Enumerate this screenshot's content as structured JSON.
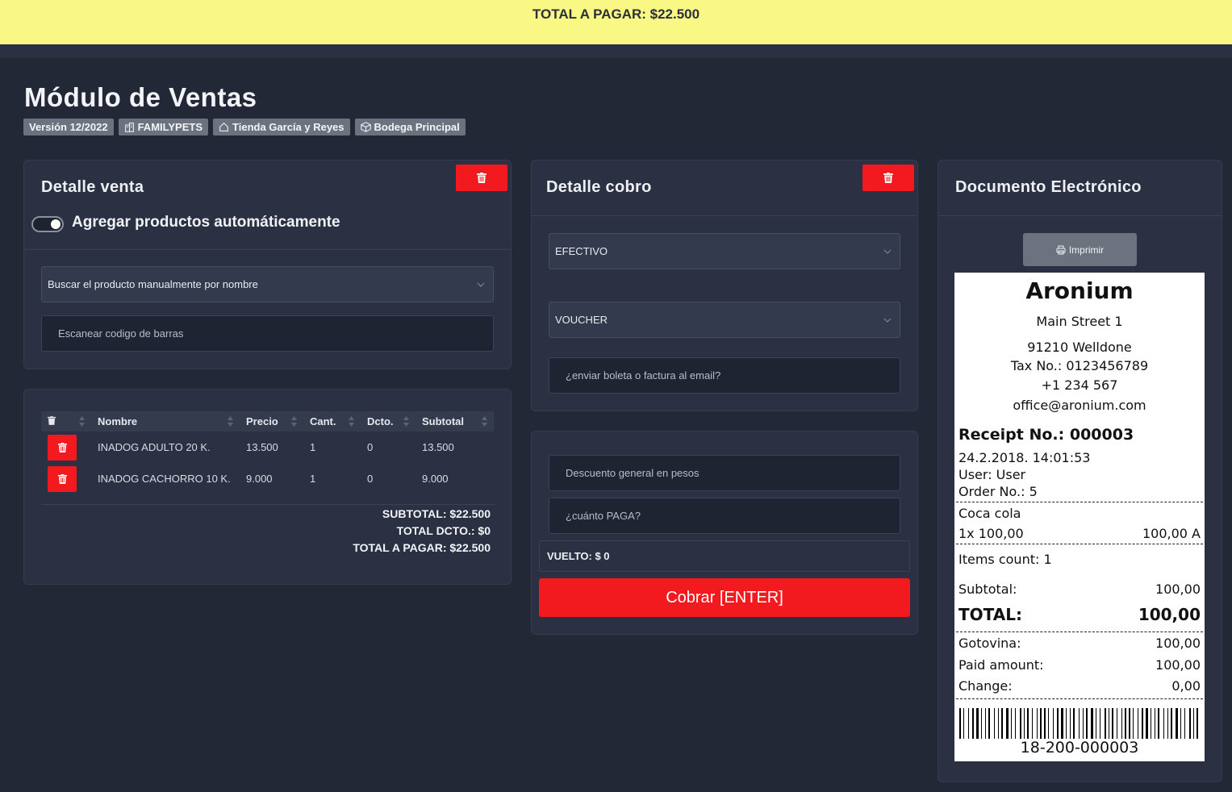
{
  "header": {
    "total_banner": "TOTAL A PAGAR: $22.500"
  },
  "page": {
    "title": "Módulo de Ventas",
    "badges": [
      "Versión 12/2022",
      "FAMILYPETS",
      "Tienda García y Reyes",
      "Bodega Principal"
    ]
  },
  "sale_detail": {
    "title": "Detalle venta",
    "toggle_label": "Agregar productos automáticamente",
    "search_select": "Buscar el producto manualmente por nombre",
    "barcode_placeholder": "Escanear codigo de barras"
  },
  "table": {
    "columns": [
      "Nombre",
      "Precio",
      "Cant.",
      "Dcto.",
      "Subtotal"
    ],
    "rows": [
      {
        "name": "INADOG ADULTO 20 K.",
        "price": "13.500",
        "qty": "1",
        "discount": "0",
        "subtotal": "13.500"
      },
      {
        "name": "INADOG CACHORRO 10 K.",
        "price": "9.000",
        "qty": "1",
        "discount": "0",
        "subtotal": "9.000"
      }
    ],
    "subtotal": "SUBTOTAL: $22.500",
    "total_discount": "TOTAL DCTO.: $0",
    "total_to_pay": "TOTAL A PAGAR: $22.500"
  },
  "payment_detail": {
    "title": "Detalle cobro",
    "method_1": "EFECTIVO",
    "method_2": "VOUCHER",
    "email_placeholder": "¿enviar boleta o factura al email?",
    "discount_placeholder": "Descuento general en pesos",
    "pay_placeholder": "¿cuánto PAGA?",
    "change": "VUELTO: $ 0",
    "charge_button": "Cobrar [ENTER]"
  },
  "document": {
    "title": "Documento Electrónico",
    "print_button": "Imprimir"
  },
  "receipt": {
    "store": "Aronium",
    "address1": "Main Street 1",
    "address2": "91210 Welldone",
    "tax": "Tax No.: 0123456789",
    "phone": "+1 234 567",
    "email": "office@aronium.com",
    "receipt_no": "Receipt No.: 000003",
    "datetime": "24.2.2018. 14:01:53",
    "user": "User: User",
    "order": "Order No.: 5",
    "item_name": "Coca cola",
    "item_qty": "1x 100,00",
    "item_total": "100,00 A",
    "items_count": "Items count: 1",
    "subtotal_label": "Subtotal:",
    "subtotal_value": "100,00",
    "total_label": "TOTAL:",
    "total_value": "100,00",
    "cash_label": "Gotovina:",
    "cash_value": "100,00",
    "paid_label": "Paid amount:",
    "paid_value": "100,00",
    "change_label": "Change:",
    "change_value": "0,00",
    "barcode_text": "18-200-000003"
  },
  "colors": {
    "accent_red": "#f31a1f",
    "banner_yellow": "#f9f884",
    "background": "#222836",
    "card": "#2b3142"
  }
}
